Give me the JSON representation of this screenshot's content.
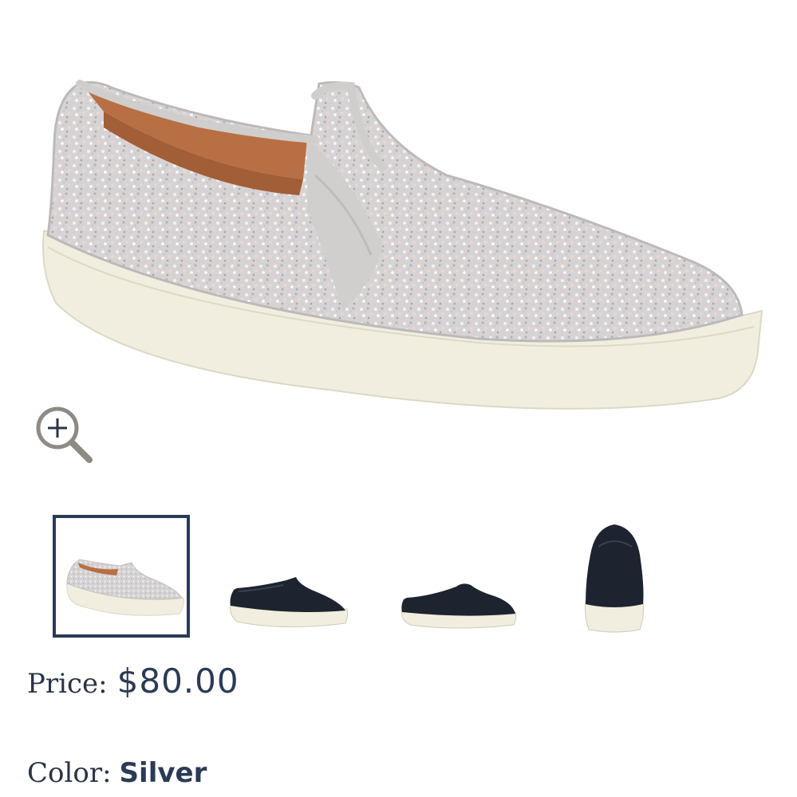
{
  "product": {
    "main_image_icon": "silver-glitter-slip-on-sneaker",
    "zoom_icon": "zoom-in-icon",
    "thumbnails": [
      {
        "icon": "silver-glitter-sneaker-thumbnail",
        "selected": true
      },
      {
        "icon": "black-sneaker-side-thumbnail",
        "selected": false
      },
      {
        "icon": "black-sneaker-angled-thumbnail",
        "selected": false
      },
      {
        "icon": "black-sneaker-heel-thumbnail",
        "selected": false
      }
    ],
    "price_label": "Price:",
    "price_value": "$80.00",
    "color_label": "Color:",
    "color_value": "Silver"
  },
  "colors": {
    "text": "#2b3445",
    "accent": "#2b3a55",
    "selected_border": "#2b3a55"
  }
}
